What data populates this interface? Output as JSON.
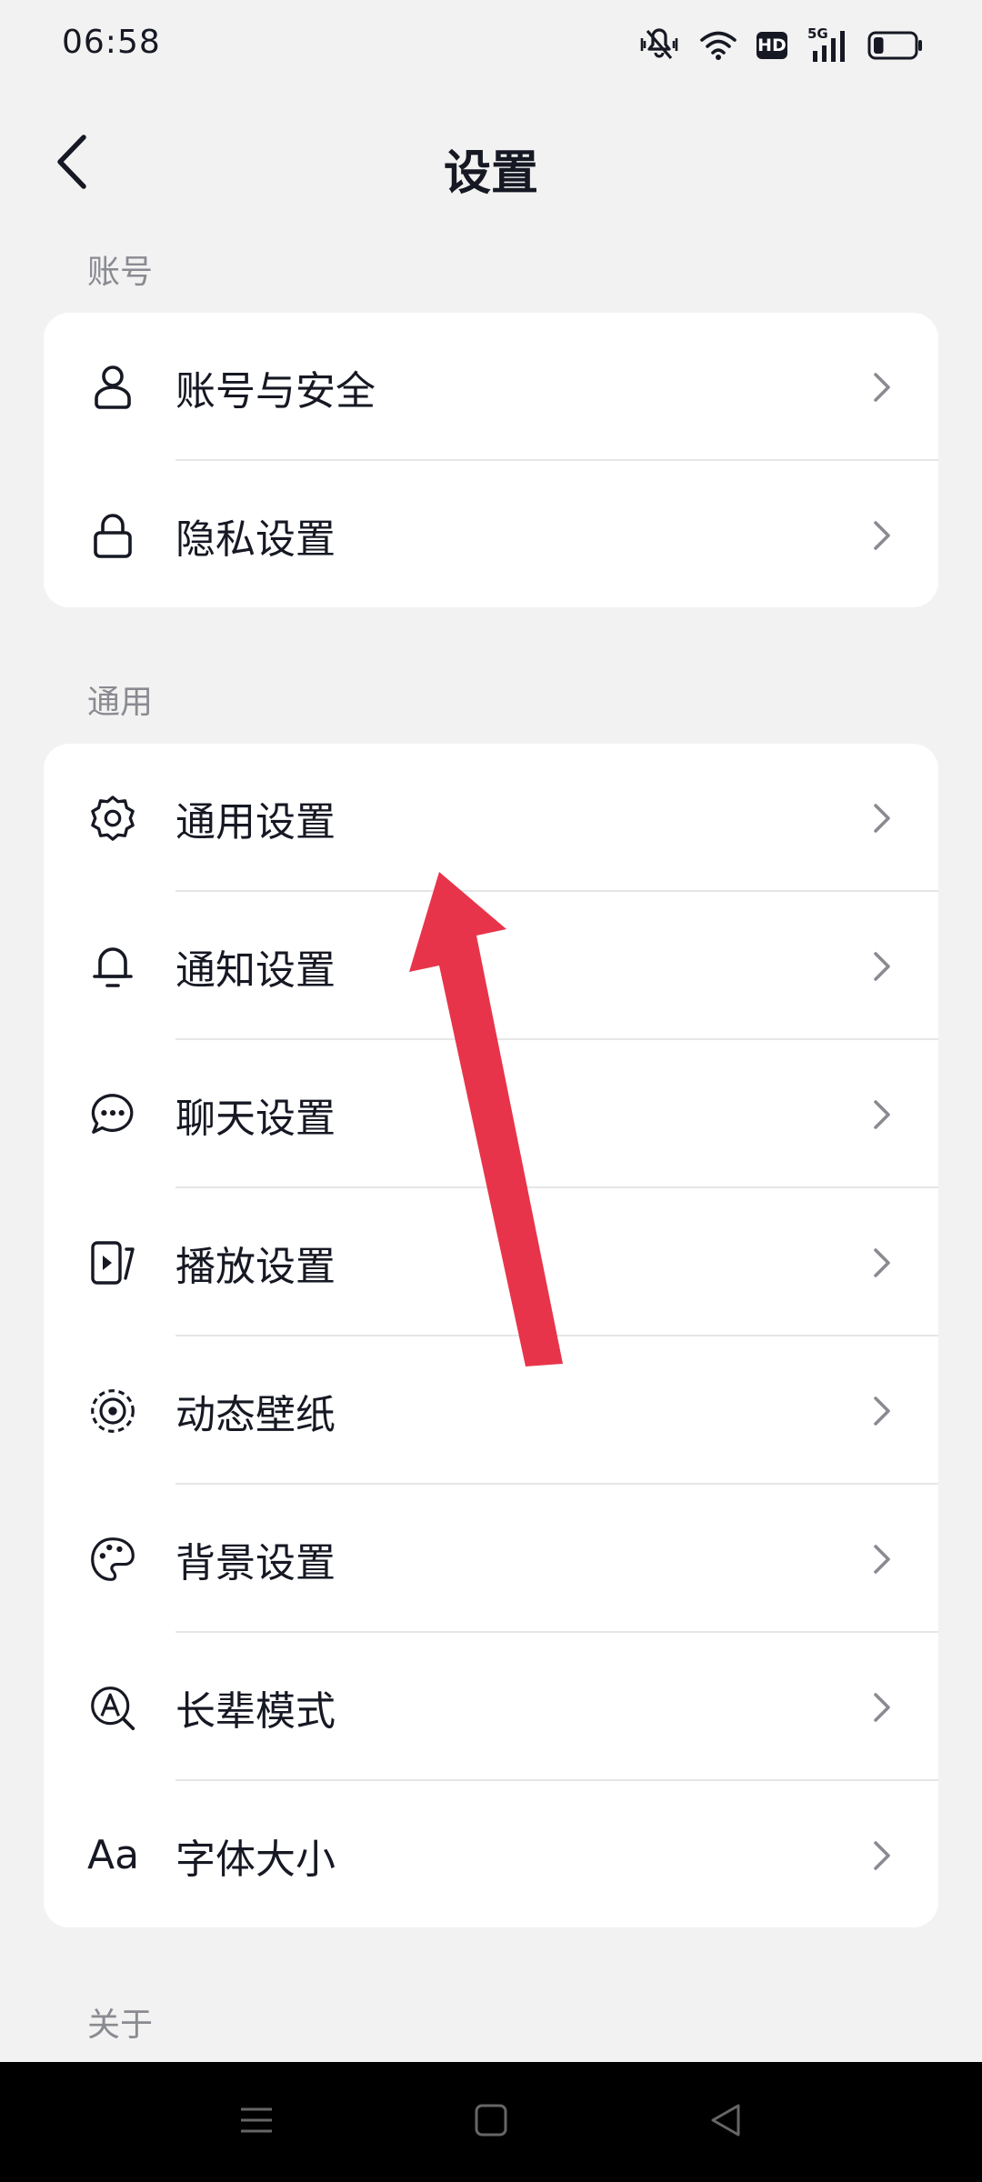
{
  "status_bar": {
    "time": "06:58",
    "icons": [
      "mute-vibrate-icon",
      "wifi-icon",
      "hd-icon",
      "5g-signal-icon",
      "battery-icon"
    ],
    "hd_label": "HD",
    "network_label": "5G",
    "battery_level": 0.25
  },
  "header": {
    "title": "设置",
    "back_icon": "chevron-left-icon"
  },
  "sections": {
    "account": {
      "label": "账号",
      "items": [
        {
          "label": "账号与安全",
          "icon": "user-icon"
        },
        {
          "label": "隐私设置",
          "icon": "lock-icon"
        }
      ]
    },
    "general": {
      "label": "通用",
      "items": [
        {
          "label": "通用设置",
          "icon": "gear-icon"
        },
        {
          "label": "通知设置",
          "icon": "bell-icon"
        },
        {
          "label": "聊天设置",
          "icon": "chat-bubble-icon"
        },
        {
          "label": "播放设置",
          "icon": "play-icon"
        },
        {
          "label": "动态壁纸",
          "icon": "wallpaper-icon"
        },
        {
          "label": "背景设置",
          "icon": "palette-icon"
        },
        {
          "label": "长辈模式",
          "icon": "elder-mode-icon"
        },
        {
          "label": "字体大小",
          "icon": "font-size-icon",
          "icon_text": "Aa"
        }
      ]
    },
    "about": {
      "label": "关于"
    }
  },
  "annotation": {
    "type": "arrow",
    "color": "#e8344a",
    "points_to": "通用设置"
  },
  "nav_bar": {
    "buttons": [
      "menu-icon",
      "home-icon",
      "back-triangle-icon"
    ]
  }
}
